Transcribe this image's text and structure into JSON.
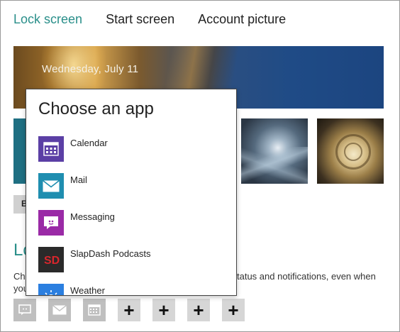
{
  "tabs": [
    {
      "label": "Lock screen",
      "active": true
    },
    {
      "label": "Start screen",
      "active": false
    },
    {
      "label": "Account picture",
      "active": false
    }
  ],
  "preview": {
    "date": "Wednesday, July 11"
  },
  "browse_button": {
    "label": "B"
  },
  "section": {
    "heading": "Lock screen apps",
    "description_left": "Choose apps to run in the background and show quick",
    "description_right": "tatus and notifications, even when",
    "description_line2": "your screen is locked"
  },
  "popup": {
    "title": "Choose an app",
    "apps": [
      {
        "label": "Calendar",
        "icon": "calendar-icon",
        "color": "#5b3fa5"
      },
      {
        "label": "Mail",
        "icon": "mail-icon",
        "color": "#1f8eb0"
      },
      {
        "label": "Messaging",
        "icon": "messaging-icon",
        "color": "#9a2aa6"
      },
      {
        "label": "SlapDash Podcasts",
        "icon": "slapdash-podcasts-icon",
        "color": "#2a2a2a"
      },
      {
        "label": "Weather",
        "icon": "weather-icon",
        "color": "#2b7fe0"
      }
    ]
  },
  "slots": [
    {
      "kind": "messaging-icon"
    },
    {
      "kind": "mail-icon"
    },
    {
      "kind": "calendar-icon"
    },
    {
      "kind": "add",
      "label": "+"
    },
    {
      "kind": "add",
      "label": "+"
    },
    {
      "kind": "add",
      "label": "+"
    },
    {
      "kind": "add",
      "label": "+"
    }
  ],
  "colors": {
    "accent": "#2a8f8a",
    "slot_bg": "#bfbfbf"
  }
}
